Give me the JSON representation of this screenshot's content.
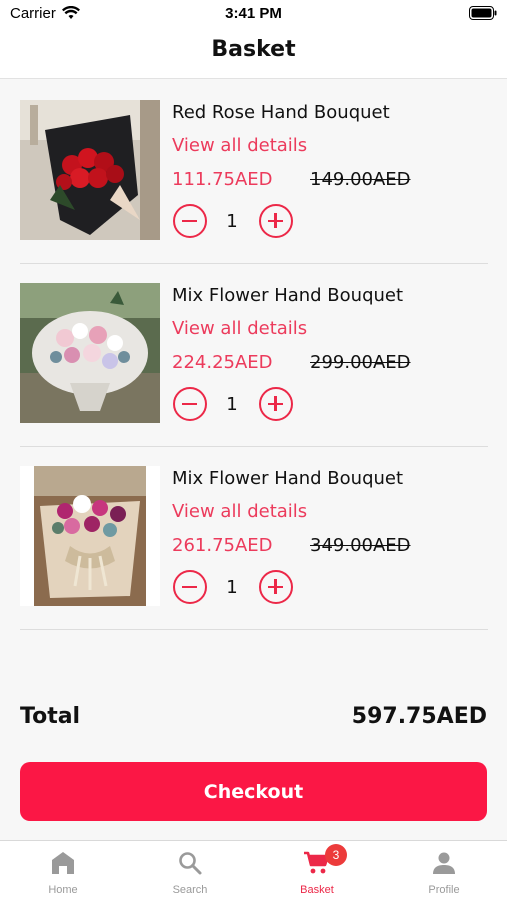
{
  "status_bar": {
    "carrier": "Carrier",
    "time": "3:41 PM"
  },
  "header": {
    "title": "Basket"
  },
  "items": [
    {
      "name": "Red Rose Hand Bouquet",
      "details_link": "View all details",
      "price": "111.75AED",
      "old_price": "149.00AED",
      "quantity": "1"
    },
    {
      "name": "Mix Flower Hand Bouquet",
      "details_link": "View all details",
      "price": "224.25AED",
      "old_price": "299.00AED",
      "quantity": "1"
    },
    {
      "name": "Mix Flower Hand Bouquet",
      "details_link": "View all details",
      "price": "261.75AED",
      "old_price": "349.00AED",
      "quantity": "1"
    }
  ],
  "summary": {
    "total_label": "Total",
    "total_value": "597.75AED",
    "checkout_label": "Checkout"
  },
  "tab_bar": {
    "tabs": [
      {
        "label": "Home",
        "icon": "home-icon"
      },
      {
        "label": "Search",
        "icon": "search-icon"
      },
      {
        "label": "Basket",
        "icon": "cart-icon",
        "active": true
      },
      {
        "label": "Profile",
        "icon": "profile-icon"
      }
    ],
    "cart_badge": "3"
  },
  "colors": {
    "accent": "#ec2848",
    "checkout": "#fb1745",
    "price": "#ec3b5c"
  }
}
